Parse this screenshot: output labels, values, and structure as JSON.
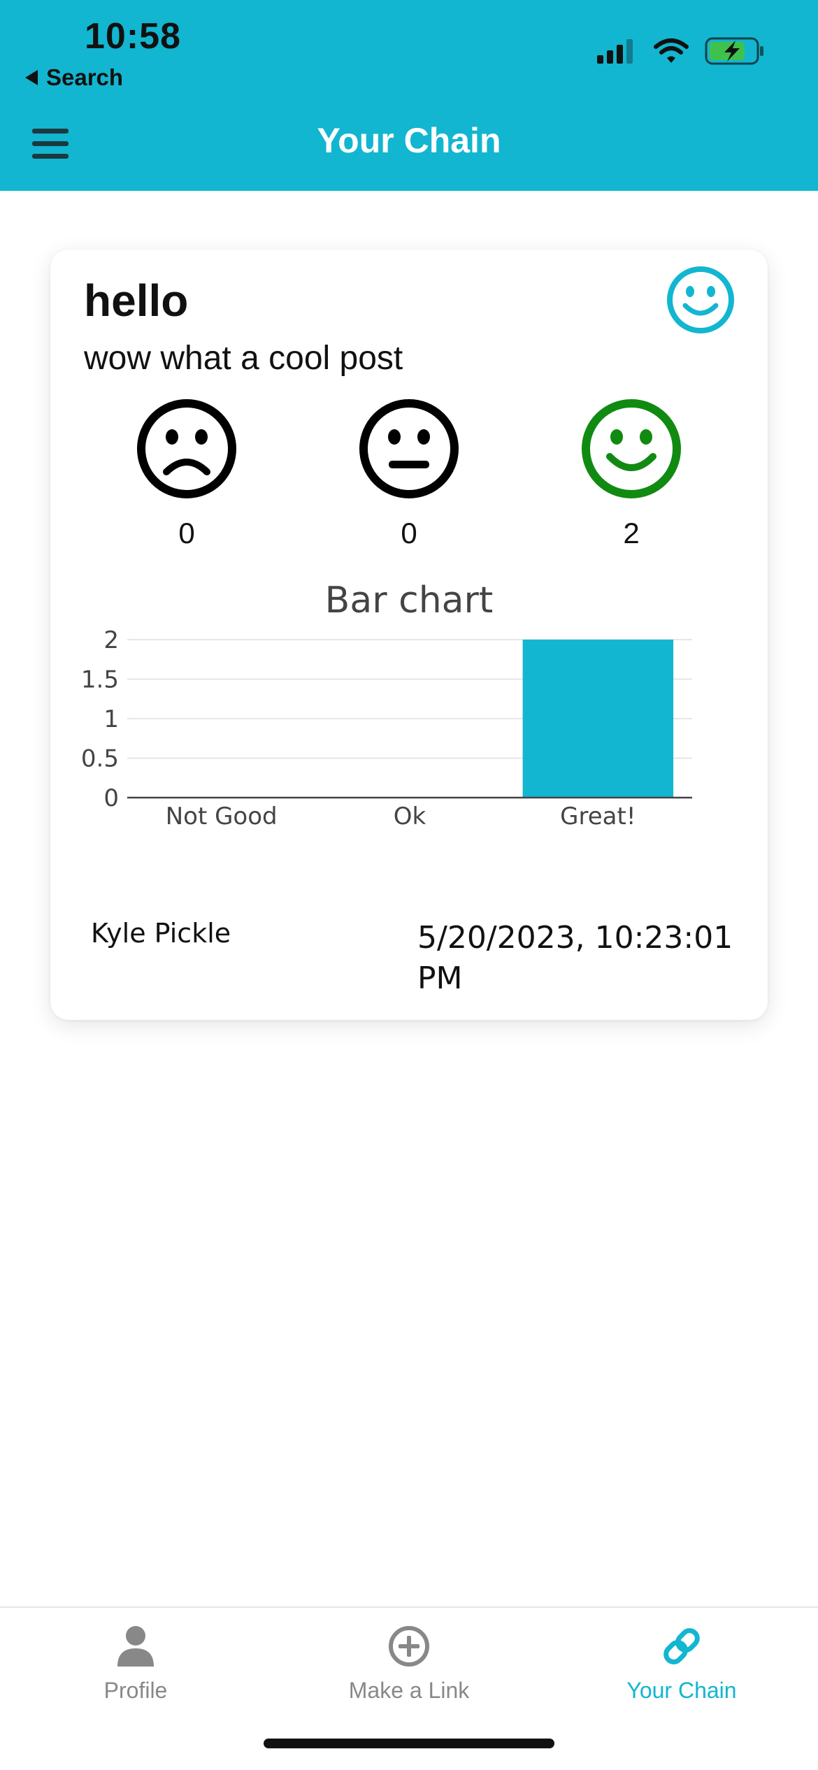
{
  "status_bar": {
    "time": "10:58",
    "back_label": "Search"
  },
  "header": {
    "title": "Your Chain",
    "background_color": "#12b6d0"
  },
  "post": {
    "title": "hello",
    "body": "wow what a cool post",
    "reaction_icon": "smile-icon",
    "moods": [
      {
        "icon": "frown-face-icon",
        "count": "0",
        "color": "#000000"
      },
      {
        "icon": "neutral-face-icon",
        "count": "0",
        "color": "#000000"
      },
      {
        "icon": "smile-face-icon",
        "count": "2",
        "color": "#118a11"
      }
    ],
    "author": "Kyle Pickle",
    "timestamp": "5/20/2023, 10:23:01 PM"
  },
  "chart_data": {
    "type": "bar",
    "title": "Bar chart",
    "categories": [
      "Not Good",
      "Ok",
      "Great!"
    ],
    "values": [
      0,
      0,
      2
    ],
    "ylim": [
      0,
      2
    ],
    "yticks": [
      "0",
      "0.5",
      "1",
      "1.5",
      "2"
    ],
    "grid": true,
    "bar_color": "#12b6d0"
  },
  "tabbar": {
    "tabs": [
      {
        "label": "Profile",
        "icon": "person-icon",
        "active": false
      },
      {
        "label": "Make a Link",
        "icon": "plus-circle-icon",
        "active": false
      },
      {
        "label": "Your Chain",
        "icon": "link-icon",
        "active": true
      }
    ],
    "active_color": "#12b6d0",
    "inactive_color": "#888888"
  }
}
